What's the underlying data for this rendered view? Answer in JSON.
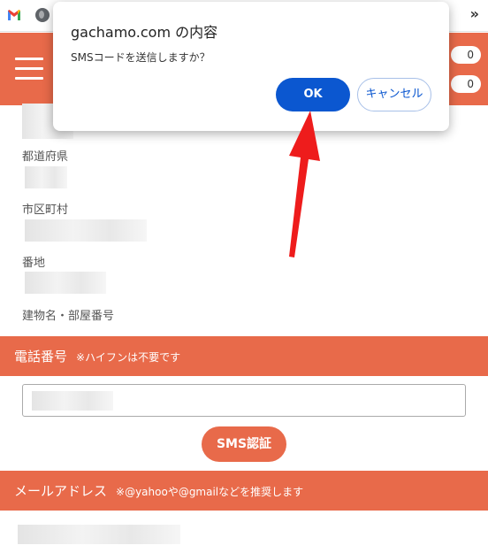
{
  "browser": {
    "more_label": "»",
    "gmail_colors": [
      "#ea4335",
      "#fbbc04",
      "#34a853",
      "#4285f4"
    ]
  },
  "header": {
    "counter_1": "0",
    "counter_2": "0",
    "color": "#e86a4a"
  },
  "form": {
    "prefecture_label": "都道府県",
    "city_label": "市区町村",
    "street_label": "番地",
    "building_label": "建物名・部屋番号"
  },
  "phone_section": {
    "title": "電話番号",
    "note": "※ハイフンは不要です",
    "sms_button": "SMS認証"
  },
  "email_section": {
    "title": "メールアドレス",
    "note": "※@yahooや@gmailなどを推奨します"
  },
  "dialog": {
    "title": "gachamo.com の内容",
    "message": "SMSコードを送信しますか？",
    "ok_label": "OK",
    "cancel_label": "キャンセル",
    "ok_color": "#0b57d0"
  },
  "annotation": {
    "arrow_color": "#ee1c1c"
  }
}
